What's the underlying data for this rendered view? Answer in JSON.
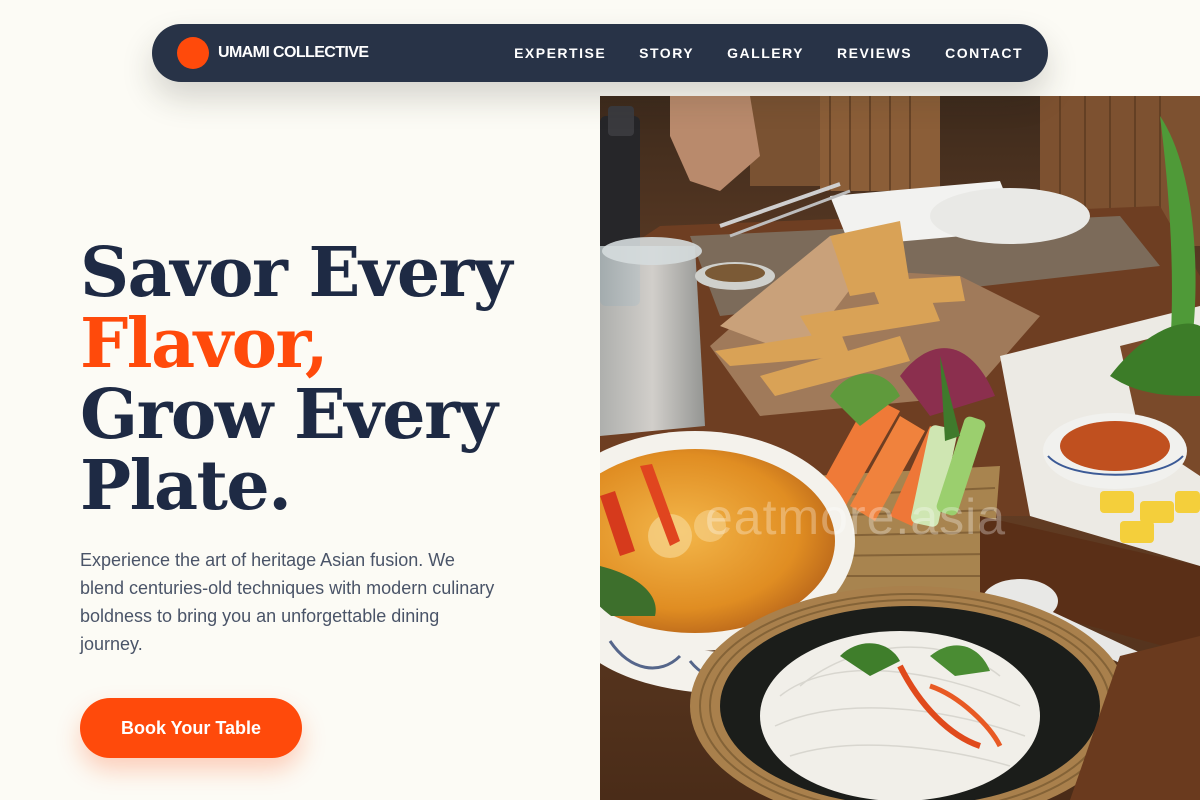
{
  "nav": {
    "brand": "UMAMI COLLECTIVE",
    "links": [
      "EXPERTISE",
      "STORY",
      "GALLERY",
      "REVIEWS",
      "CONTACT"
    ]
  },
  "hero": {
    "title_line1": "Savor Every",
    "title_line2": "Flavor,",
    "title_line3": "Grow Every",
    "title_line4": "Plate.",
    "description": "Experience the art of heritage Asian fusion. We blend centuries-old techniques with modern culinary boldness to bring you an unforgettable dining journey.",
    "cta_label": "Book Your Table"
  },
  "image": {
    "watermark": "eatmore.asia",
    "subject": "heritage-asian-food-spread-photo"
  },
  "colors": {
    "accent": "#ff4a0b",
    "navy": "#1e2a44",
    "nav_bg": "#283347",
    "page_bg": "#fcfbf5",
    "body_text": "#4a5468"
  }
}
